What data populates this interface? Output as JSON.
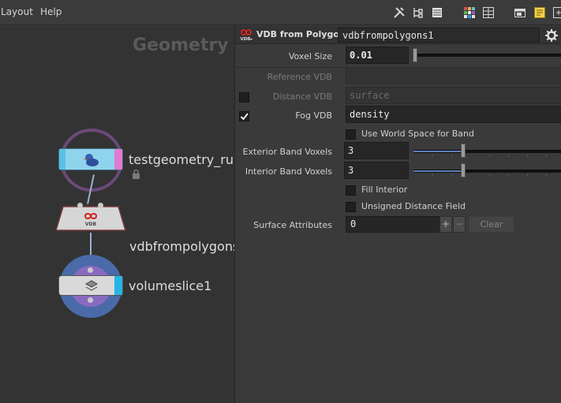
{
  "menubar": {
    "menus": [
      "Layout",
      "Help"
    ],
    "toolbar_icons": [
      "tools-icon",
      "tree-icon",
      "list-icon",
      "grid-color-icon",
      "grid-icon",
      "window-icon",
      "note-icon",
      "expand-icon"
    ]
  },
  "network": {
    "title": "Geometry",
    "nodes": [
      {
        "name": "testgeometry_rub"
      },
      {
        "name": "vdbfrompolygons"
      },
      {
        "name": "volumeslice1"
      }
    ]
  },
  "params": {
    "node_type": "VDB from Polygons",
    "type_badge": "VDB",
    "node_name": "vdbfrompolygons1",
    "voxel_size": {
      "label": "Voxel Size",
      "value": "0.01"
    },
    "reference_vdb": {
      "label": "Reference VDB",
      "value": ""
    },
    "distance_vdb": {
      "label": "Distance VDB",
      "value": "surface",
      "checked": false
    },
    "fog_vdb": {
      "label": "Fog VDB",
      "value": "density",
      "checked": true
    },
    "use_world_space": {
      "label": "Use World Space for Band",
      "checked": false
    },
    "exterior_band": {
      "label": "Exterior Band Voxels",
      "value": "3",
      "slider_fraction": 0.33
    },
    "interior_band": {
      "label": "Interior Band Voxels",
      "value": "3",
      "slider_fraction": 0.33
    },
    "fill_interior": {
      "label": "Fill Interior",
      "checked": false
    },
    "unsigned_distance": {
      "label": "Unsigned Distance Field",
      "checked": false
    },
    "surface_attributes": {
      "label": "Surface Attributes",
      "value": "0",
      "plus": "+",
      "minus": "−",
      "clear": "Clear"
    }
  },
  "colors": {
    "accent": "#5d7fb8",
    "node_ring_purple": "#6b4a78",
    "node_ring_blue": "#4a6aa8"
  }
}
